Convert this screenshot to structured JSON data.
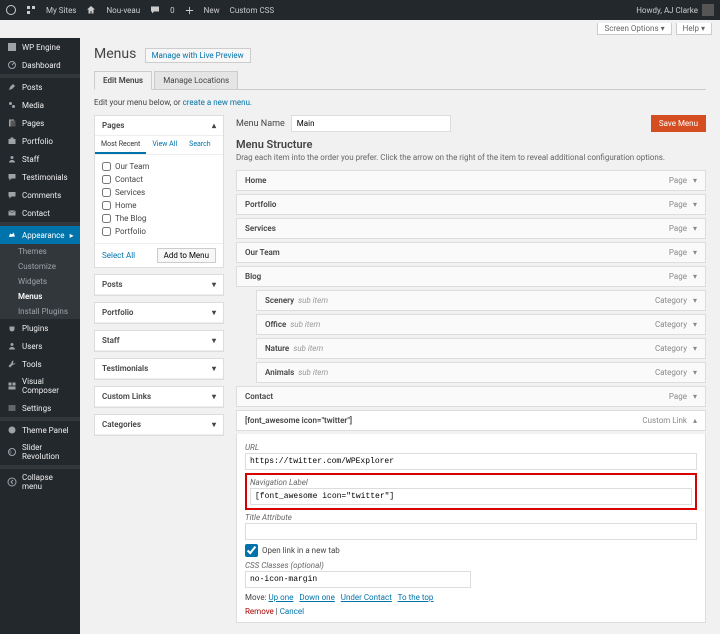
{
  "topbar": {
    "mysites": "My Sites",
    "site": "Nou-veau",
    "comments": "0",
    "new": "New",
    "css": "Custom CSS",
    "howdy": "Howdy, AJ Clarke"
  },
  "screen": {
    "options": "Screen Options ▾",
    "help": "Help ▾"
  },
  "sidebar": {
    "items": [
      {
        "label": "WP Engine"
      },
      {
        "label": "Dashboard"
      },
      {
        "label": "Posts"
      },
      {
        "label": "Media"
      },
      {
        "label": "Pages"
      },
      {
        "label": "Portfolio"
      },
      {
        "label": "Staff"
      },
      {
        "label": "Testimonials"
      },
      {
        "label": "Comments"
      },
      {
        "label": "Contact"
      },
      {
        "label": "Appearance"
      },
      {
        "label": "Plugins"
      },
      {
        "label": "Users"
      },
      {
        "label": "Tools"
      },
      {
        "label": "Visual Composer"
      },
      {
        "label": "Settings"
      },
      {
        "label": "Theme Panel"
      },
      {
        "label": "Slider Revolution"
      },
      {
        "label": "Collapse menu"
      }
    ],
    "submenu": [
      {
        "label": "Themes"
      },
      {
        "label": "Customize"
      },
      {
        "label": "Widgets"
      },
      {
        "label": "Menus"
      },
      {
        "label": "Install Plugins"
      }
    ]
  },
  "page": {
    "title": "Menus",
    "live": "Manage with Live Preview"
  },
  "tabs": {
    "edit": "Edit Menus",
    "manage": "Manage Locations"
  },
  "hint": {
    "pre": "Edit your menu below, or ",
    "link": "create a new menu."
  },
  "pages_panel": {
    "title": "Pages",
    "tabs": {
      "recent": "Most Recent",
      "all": "View All",
      "search": "Search"
    },
    "items": [
      "Our Team",
      "Contact",
      "Services",
      "Home",
      "The Blog",
      "Portfolio"
    ],
    "select_all": "Select All",
    "add": "Add to Menu"
  },
  "collapsed": [
    "Posts",
    "Portfolio",
    "Staff",
    "Testimonials",
    "Custom Links",
    "Categories"
  ],
  "menu": {
    "name_label": "Menu Name",
    "name_value": "Main",
    "save": "Save Menu"
  },
  "structure": {
    "title": "Menu Structure",
    "desc": "Drag each item into the order you prefer. Click the arrow on the right of the item to reveal additional configuration options.",
    "items": [
      {
        "title": "Home",
        "type": "Page"
      },
      {
        "title": "Portfolio",
        "type": "Page"
      },
      {
        "title": "Services",
        "type": "Page"
      },
      {
        "title": "Our Team",
        "type": "Page"
      },
      {
        "title": "Blog",
        "type": "Page"
      },
      {
        "title": "Scenery",
        "type": "Category",
        "sub": true
      },
      {
        "title": "Office",
        "type": "Category",
        "sub": true
      },
      {
        "title": "Nature",
        "type": "Category",
        "sub": true
      },
      {
        "title": "Animals",
        "type": "Category",
        "sub": true
      },
      {
        "title": "Contact",
        "type": "Page"
      }
    ],
    "sub_label": "sub item",
    "open": {
      "title": "[font_awesome icon=\"twitter\"]",
      "type": "Custom Link"
    }
  },
  "detail": {
    "url_label": "URL",
    "url": "https://twitter.com/WPExplorer",
    "nav_label": "Navigation Label",
    "nav": "[font_awesome icon=\"twitter\"]",
    "title_attr": "Title Attribute",
    "newtab": "Open link in a new tab",
    "css_label": "CSS Classes (optional)",
    "css": "no-icon-margin",
    "move": "Move:",
    "up": "Up one",
    "down": "Down one",
    "under": "Under Contact",
    "top": "To the top",
    "remove": "Remove",
    "cancel": "Cancel"
  }
}
